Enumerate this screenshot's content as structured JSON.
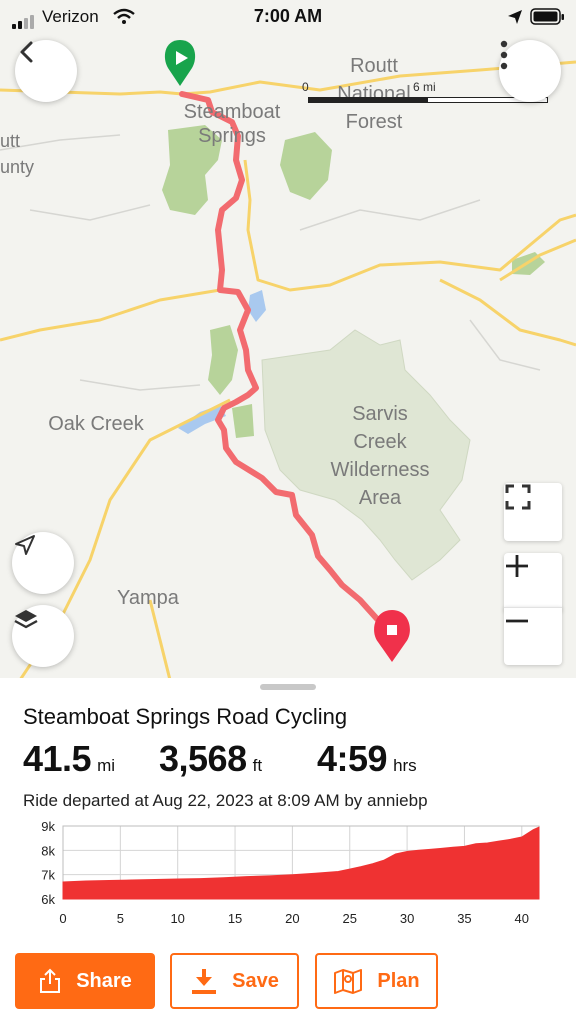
{
  "status_bar": {
    "carrier": "Verizon",
    "time": "7:00 AM"
  },
  "map": {
    "labels": {
      "steamboat_springs": "Steamboat\nSprings",
      "routt_forest": "Routt\nNational\nForest",
      "routt_county": "utt\nunty",
      "oak_creek": "Oak Creek",
      "sarvis": "Sarvis\nCreek\nWilderness\nArea",
      "yampa": "Yampa"
    },
    "scale": {
      "start": "0",
      "mid": "6 mi",
      "end": "mi",
      "filled_fraction": 0.5
    },
    "colors": {
      "route": "#f26b6f",
      "park": "#b7d39a",
      "road": "#f7d36a",
      "water": "#a9c9ef",
      "wilderness": "#dfe6d4",
      "start_pin": "#18a44c",
      "end_pin": "#f0314b"
    },
    "icons": [
      "back-icon",
      "more-icon",
      "locate-icon",
      "layers-icon",
      "fullscreen-icon",
      "zoom-in-icon",
      "zoom-out-icon"
    ]
  },
  "ride": {
    "title": "Steamboat Springs Road Cycling",
    "distance_value": "41.5",
    "distance_unit": "mi",
    "elevation_value": "3,568",
    "elevation_unit": "ft",
    "time_value": "4:59",
    "time_unit": "hrs",
    "description": "Ride departed at Aug 22, 2023 at 8:09 AM by anniebp"
  },
  "chart_data": {
    "type": "area",
    "title": "",
    "xlabel": "",
    "ylabel": "",
    "x_ticks": [
      "0",
      "5",
      "10",
      "15",
      "20",
      "25",
      "30",
      "35",
      "40"
    ],
    "y_ticks": [
      "6k",
      "7k",
      "8k",
      "9k"
    ],
    "xlim": [
      0,
      41.5
    ],
    "ylim": [
      6000,
      9000
    ],
    "grid": true,
    "color": "#ef3232",
    "x": [
      0,
      2,
      4,
      6,
      8,
      10,
      12,
      14,
      16,
      18,
      20,
      22,
      24,
      25,
      26,
      27,
      28,
      29,
      30,
      31,
      32,
      33,
      34,
      35,
      36,
      37,
      38,
      39,
      40,
      41,
      41.5
    ],
    "y": [
      6700,
      6740,
      6760,
      6780,
      6800,
      6820,
      6840,
      6870,
      6920,
      6950,
      7000,
      7060,
      7130,
      7230,
      7330,
      7450,
      7600,
      7850,
      7950,
      8000,
      8040,
      8080,
      8130,
      8160,
      8270,
      8300,
      8380,
      8450,
      8550,
      8850,
      8950
    ]
  },
  "actions": {
    "share": "Share",
    "save": "Save",
    "plan": "Plan"
  }
}
